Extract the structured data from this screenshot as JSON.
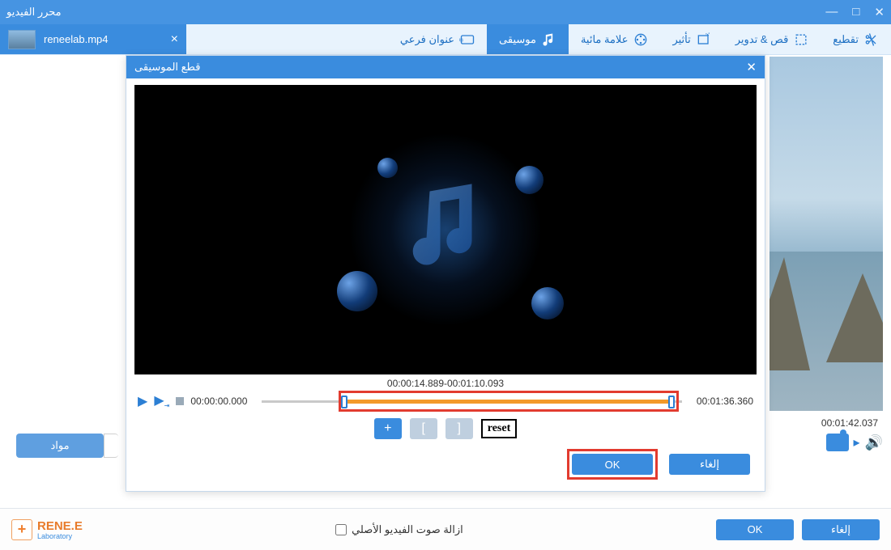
{
  "window": {
    "title": "محرر الفيديو"
  },
  "file_tab": {
    "name": "reneelab.mp4"
  },
  "toolbar": [
    {
      "id": "trim",
      "label": "تقطيع"
    },
    {
      "id": "crop",
      "label": "قص & تدوير"
    },
    {
      "id": "effect",
      "label": "تأثير"
    },
    {
      "id": "watermark",
      "label": "علامة مائية"
    },
    {
      "id": "music",
      "label": "موسيقى",
      "active": true
    },
    {
      "id": "subtitle",
      "label": "عنوان فرعي"
    }
  ],
  "materials_button": "مواد",
  "preview": {
    "time": "00:01:42.037"
  },
  "dialog": {
    "title": "قطع الموسيقى",
    "range": "00:00:14.889-00:01:10.093",
    "start": "00:00:00.000",
    "end": "00:01:36.360",
    "reset": "reset",
    "ok": "OK",
    "cancel": "إلغاء"
  },
  "footer": {
    "brand1": "RENE.E",
    "brand2": "Laboratory",
    "remove_audio": "ازالة صوت الفيديو الأصلي",
    "ok": "OK",
    "cancel": "إلغاء"
  }
}
